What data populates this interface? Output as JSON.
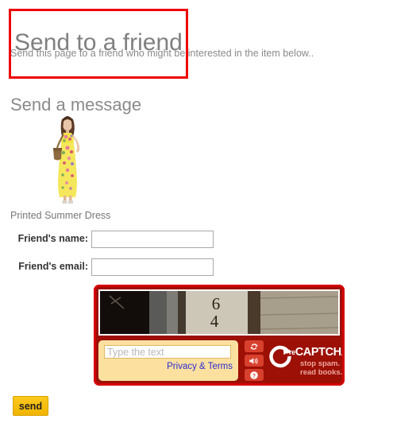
{
  "page": {
    "title": "Send to a friend",
    "subtitle": "Send this page to a friend who might be interested in the item below..",
    "section_heading": "Send a message"
  },
  "product": {
    "name": "Printed Summer Dress",
    "image_alt": "woman-in-yellow-floral-maxi-dress-with-brown-handbag"
  },
  "form": {
    "fields": [
      {
        "label": "Friend's name:",
        "value": "",
        "placeholder": ""
      },
      {
        "label": "Friend's email:",
        "value": "",
        "placeholder": ""
      }
    ],
    "submit_label": "send"
  },
  "captcha": {
    "challenge_alt": "photo-of-house-number-64",
    "input_placeholder": "Type the text",
    "input_value": "",
    "privacy_link": "Privacy & Terms",
    "brand_re": "re",
    "brand_captcha": "CAPTCHA",
    "brand_tm": "™",
    "tagline_line1": "stop spam.",
    "tagline_line2": "read books.",
    "buttons": [
      {
        "name": "refresh-icon",
        "title": "Get a new challenge"
      },
      {
        "name": "audio-icon",
        "title": "Get an audio challenge"
      },
      {
        "name": "help-icon",
        "title": "Help"
      }
    ]
  },
  "colors": {
    "annotation_red": "#d40000",
    "captcha_bg": "#9c1006",
    "captcha_button": "#d8402e",
    "entry_bg": "#fce0a0",
    "send_button": "#f5be10",
    "heading_gray": "#8a8a8a"
  }
}
